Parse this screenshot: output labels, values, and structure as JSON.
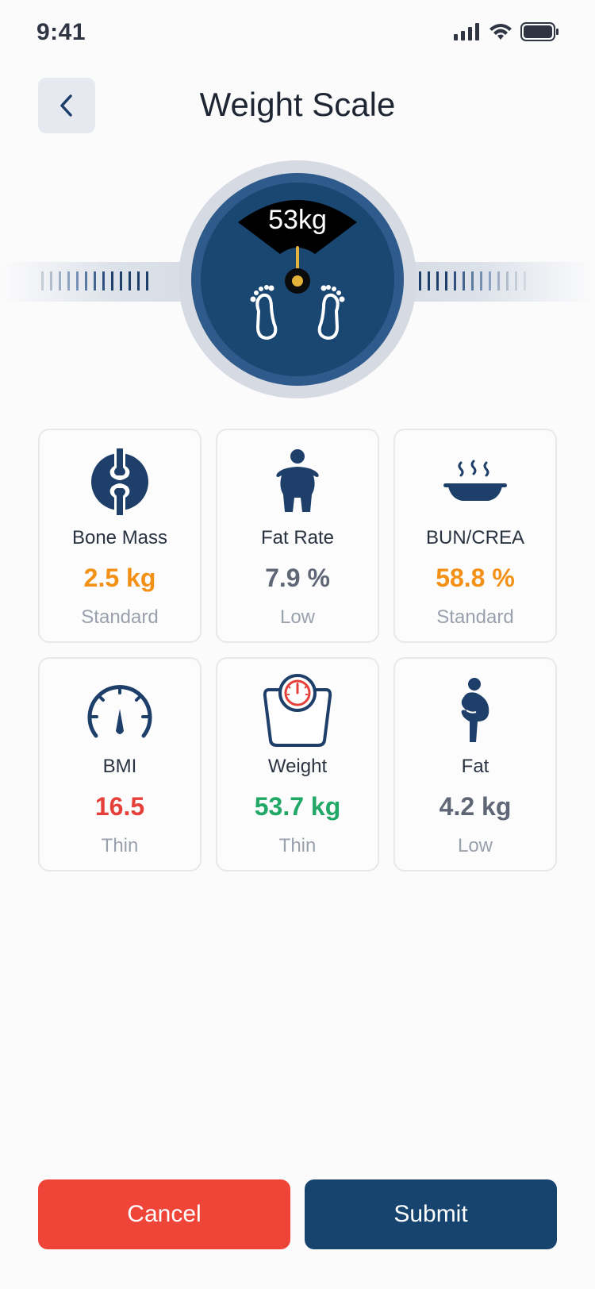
{
  "status_bar": {
    "time": "9:41"
  },
  "header": {
    "title": "Weight Scale"
  },
  "scale": {
    "reading": "53kg"
  },
  "metrics": [
    {
      "label": "Bone Mass",
      "value": "2.5 kg",
      "status": "Standard",
      "icon": "joint-icon",
      "color": "#f39016"
    },
    {
      "label": "Fat Rate",
      "value": "7.9 %",
      "status": "Low",
      "icon": "body-icon",
      "color": "#5f6776"
    },
    {
      "label": "BUN/CREA",
      "value": "58.8 %",
      "status": "Standard",
      "icon": "bowl-icon",
      "color": "#f39016"
    },
    {
      "label": "BMI",
      "value": "16.5",
      "status": "Thin",
      "icon": "gauge-icon",
      "color": "#e5403a"
    },
    {
      "label": "Weight",
      "value": "53.7 kg",
      "status": "Thin",
      "icon": "scale-icon",
      "color": "#22a866"
    },
    {
      "label": "Fat",
      "value": "4.2 kg",
      "status": "Low",
      "icon": "belly-icon",
      "color": "#5f6776"
    }
  ],
  "actions": {
    "cancel_label": "Cancel",
    "submit_label": "Submit"
  },
  "colors": {
    "primary": "#17446f",
    "danger": "#ef4538",
    "warning": "#f39016",
    "success": "#22a866"
  }
}
